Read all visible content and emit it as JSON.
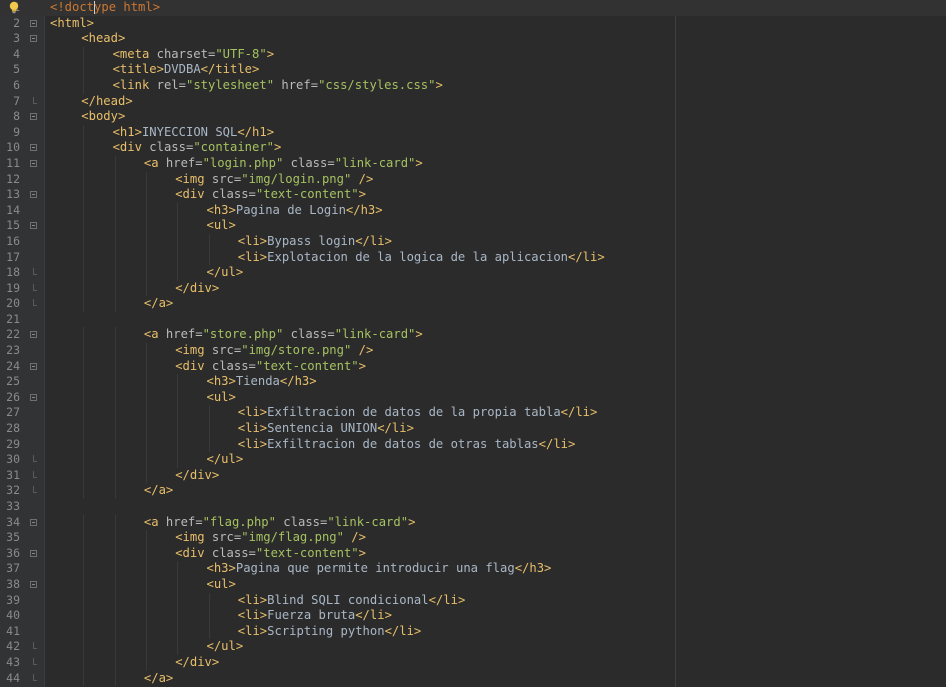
{
  "editor": {
    "language": "html",
    "colors": {
      "background": "#2b2b2b",
      "gutter": "#313335",
      "tag": "#e8bf6a",
      "attribute": "#bababa",
      "value": "#a5c261",
      "text": "#a9b7c6"
    },
    "intention_icon": "lightbulb-icon",
    "lines": [
      {
        "n": "1",
        "fold": "",
        "indent": 0,
        "current": true,
        "tokens": [
          [
            "doctype",
            "<!doct"
          ],
          [
            "caret",
            ""
          ],
          [
            "doctype",
            "ype html>"
          ]
        ]
      },
      {
        "n": "2",
        "fold": "open",
        "indent": 0,
        "tokens": [
          [
            "tag",
            "<html>"
          ]
        ]
      },
      {
        "n": "3",
        "fold": "open",
        "indent": 1,
        "tokens": [
          [
            "tag",
            "<head>"
          ]
        ]
      },
      {
        "n": "4",
        "fold": "",
        "indent": 2,
        "tokens": [
          [
            "tag",
            "<meta "
          ],
          [
            "attr",
            "charset="
          ],
          [
            "val",
            "\"UTF-8\""
          ],
          [
            "tag",
            ">"
          ]
        ]
      },
      {
        "n": "5",
        "fold": "",
        "indent": 2,
        "tokens": [
          [
            "tag",
            "<title>"
          ],
          [
            "text",
            "DVDBA"
          ],
          [
            "tag",
            "</title>"
          ]
        ]
      },
      {
        "n": "6",
        "fold": "",
        "indent": 2,
        "tokens": [
          [
            "tag",
            "<link "
          ],
          [
            "attr",
            "rel="
          ],
          [
            "val",
            "\"stylesheet\""
          ],
          [
            "attr",
            " href="
          ],
          [
            "val",
            "\"css/styles.css\""
          ],
          [
            "tag",
            ">"
          ]
        ]
      },
      {
        "n": "7",
        "fold": "end",
        "indent": 1,
        "tokens": [
          [
            "tag",
            "</head>"
          ]
        ]
      },
      {
        "n": "8",
        "fold": "open",
        "indent": 1,
        "tokens": [
          [
            "tag",
            "<body>"
          ]
        ]
      },
      {
        "n": "9",
        "fold": "",
        "indent": 2,
        "tokens": [
          [
            "tag",
            "<h1>"
          ],
          [
            "text",
            "INYECCION SQL"
          ],
          [
            "tag",
            "</h1>"
          ]
        ]
      },
      {
        "n": "10",
        "fold": "open",
        "indent": 2,
        "tokens": [
          [
            "tag",
            "<div "
          ],
          [
            "attr",
            "class="
          ],
          [
            "val",
            "\"container\""
          ],
          [
            "tag",
            ">"
          ]
        ]
      },
      {
        "n": "11",
        "fold": "open",
        "indent": 3,
        "tokens": [
          [
            "tag",
            "<a "
          ],
          [
            "attr",
            "href="
          ],
          [
            "val",
            "\"login.php\""
          ],
          [
            "attr",
            " class="
          ],
          [
            "val",
            "\"link-card\""
          ],
          [
            "tag",
            ">"
          ]
        ]
      },
      {
        "n": "12",
        "fold": "",
        "indent": 4,
        "tokens": [
          [
            "tag",
            "<img "
          ],
          [
            "attr",
            "src="
          ],
          [
            "val",
            "\"img/login.png\""
          ],
          [
            "tag",
            " />"
          ]
        ]
      },
      {
        "n": "13",
        "fold": "open",
        "indent": 4,
        "tokens": [
          [
            "tag",
            "<div "
          ],
          [
            "attr",
            "class="
          ],
          [
            "val",
            "\"text-content\""
          ],
          [
            "tag",
            ">"
          ]
        ]
      },
      {
        "n": "14",
        "fold": "",
        "indent": 5,
        "tokens": [
          [
            "tag",
            "<h3>"
          ],
          [
            "text",
            "Pagina de Login"
          ],
          [
            "tag",
            "</h3>"
          ]
        ]
      },
      {
        "n": "15",
        "fold": "open",
        "indent": 5,
        "tokens": [
          [
            "tag",
            "<ul>"
          ]
        ]
      },
      {
        "n": "16",
        "fold": "",
        "indent": 6,
        "tokens": [
          [
            "tag",
            "<li>"
          ],
          [
            "text",
            "Bypass login"
          ],
          [
            "tag",
            "</li>"
          ]
        ]
      },
      {
        "n": "17",
        "fold": "",
        "indent": 6,
        "tokens": [
          [
            "tag",
            "<li>"
          ],
          [
            "text",
            "Explotacion de la logica de la aplicacion"
          ],
          [
            "tag",
            "</li>"
          ]
        ]
      },
      {
        "n": "18",
        "fold": "end",
        "indent": 5,
        "tokens": [
          [
            "tag",
            "</ul>"
          ]
        ]
      },
      {
        "n": "19",
        "fold": "end",
        "indent": 4,
        "tokens": [
          [
            "tag",
            "</div>"
          ]
        ]
      },
      {
        "n": "20",
        "fold": "end",
        "indent": 3,
        "tokens": [
          [
            "tag",
            "</a>"
          ]
        ]
      },
      {
        "n": "21",
        "fold": "",
        "indent": 0,
        "tokens": []
      },
      {
        "n": "22",
        "fold": "open",
        "indent": 3,
        "tokens": [
          [
            "tag",
            "<a "
          ],
          [
            "attr",
            "href="
          ],
          [
            "val",
            "\"store.php\""
          ],
          [
            "attr",
            " class="
          ],
          [
            "val",
            "\"link-card\""
          ],
          [
            "tag",
            ">"
          ]
        ]
      },
      {
        "n": "23",
        "fold": "",
        "indent": 4,
        "tokens": [
          [
            "tag",
            "<img "
          ],
          [
            "attr",
            "src="
          ],
          [
            "val",
            "\"img/store.png\""
          ],
          [
            "tag",
            " />"
          ]
        ]
      },
      {
        "n": "24",
        "fold": "open",
        "indent": 4,
        "tokens": [
          [
            "tag",
            "<div "
          ],
          [
            "attr",
            "class="
          ],
          [
            "val",
            "\"text-content\""
          ],
          [
            "tag",
            ">"
          ]
        ]
      },
      {
        "n": "25",
        "fold": "",
        "indent": 5,
        "tokens": [
          [
            "tag",
            "<h3>"
          ],
          [
            "text",
            "Tienda"
          ],
          [
            "tag",
            "</h3>"
          ]
        ]
      },
      {
        "n": "26",
        "fold": "open",
        "indent": 5,
        "tokens": [
          [
            "tag",
            "<ul>"
          ]
        ]
      },
      {
        "n": "27",
        "fold": "",
        "indent": 6,
        "tokens": [
          [
            "tag",
            "<li>"
          ],
          [
            "text",
            "Exfiltracion de datos de la propia tabla"
          ],
          [
            "tag",
            "</li>"
          ]
        ]
      },
      {
        "n": "28",
        "fold": "",
        "indent": 6,
        "tokens": [
          [
            "tag",
            "<li>"
          ],
          [
            "text",
            "Sentencia UNION"
          ],
          [
            "tag",
            "</li>"
          ]
        ]
      },
      {
        "n": "29",
        "fold": "",
        "indent": 6,
        "tokens": [
          [
            "tag",
            "<li>"
          ],
          [
            "text",
            "Exfiltracion de datos de otras tablas"
          ],
          [
            "tag",
            "</li>"
          ]
        ]
      },
      {
        "n": "30",
        "fold": "end",
        "indent": 5,
        "tokens": [
          [
            "tag",
            "</ul>"
          ]
        ]
      },
      {
        "n": "31",
        "fold": "end",
        "indent": 4,
        "tokens": [
          [
            "tag",
            "</div>"
          ]
        ]
      },
      {
        "n": "32",
        "fold": "end",
        "indent": 3,
        "tokens": [
          [
            "tag",
            "</a>"
          ]
        ]
      },
      {
        "n": "33",
        "fold": "",
        "indent": 0,
        "tokens": []
      },
      {
        "n": "34",
        "fold": "open",
        "indent": 3,
        "tokens": [
          [
            "tag",
            "<a "
          ],
          [
            "attr",
            "href="
          ],
          [
            "val",
            "\"flag.php\""
          ],
          [
            "attr",
            " class="
          ],
          [
            "val",
            "\"link-card\""
          ],
          [
            "tag",
            ">"
          ]
        ]
      },
      {
        "n": "35",
        "fold": "",
        "indent": 4,
        "tokens": [
          [
            "tag",
            "<img "
          ],
          [
            "attr",
            "src="
          ],
          [
            "val",
            "\"img/flag.png\""
          ],
          [
            "tag",
            " />"
          ]
        ]
      },
      {
        "n": "36",
        "fold": "open",
        "indent": 4,
        "tokens": [
          [
            "tag",
            "<div "
          ],
          [
            "attr",
            "class="
          ],
          [
            "val",
            "\"text-content\""
          ],
          [
            "tag",
            ">"
          ]
        ]
      },
      {
        "n": "37",
        "fold": "",
        "indent": 5,
        "tokens": [
          [
            "tag",
            "<h3>"
          ],
          [
            "text",
            "Pagina que permite introducir una flag"
          ],
          [
            "tag",
            "</h3>"
          ]
        ]
      },
      {
        "n": "38",
        "fold": "open",
        "indent": 5,
        "tokens": [
          [
            "tag",
            "<ul>"
          ]
        ]
      },
      {
        "n": "39",
        "fold": "",
        "indent": 6,
        "tokens": [
          [
            "tag",
            "<li>"
          ],
          [
            "text",
            "Blind SQLI condicional"
          ],
          [
            "tag",
            "</li>"
          ]
        ]
      },
      {
        "n": "40",
        "fold": "",
        "indent": 6,
        "tokens": [
          [
            "tag",
            "<li>"
          ],
          [
            "text",
            "Fuerza bruta"
          ],
          [
            "tag",
            "</li>"
          ]
        ]
      },
      {
        "n": "41",
        "fold": "",
        "indent": 6,
        "tokens": [
          [
            "tag",
            "<li>"
          ],
          [
            "text",
            "Scripting python"
          ],
          [
            "tag",
            "</li>"
          ]
        ]
      },
      {
        "n": "42",
        "fold": "end",
        "indent": 5,
        "tokens": [
          [
            "tag",
            "</ul>"
          ]
        ]
      },
      {
        "n": "43",
        "fold": "end",
        "indent": 4,
        "tokens": [
          [
            "tag",
            "</div>"
          ]
        ]
      },
      {
        "n": "44",
        "fold": "end",
        "indent": 3,
        "tokens": [
          [
            "tag",
            "</a>"
          ]
        ]
      }
    ]
  }
}
